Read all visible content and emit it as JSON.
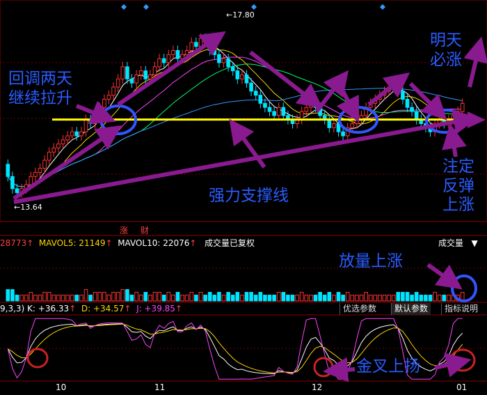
{
  "colors": {
    "up": "#ff3333",
    "down": "#00e5ff",
    "annotation_text": "#2a5cff",
    "arrow": "#8a1a8f",
    "support": "#ffff00",
    "circle_blue": "#3355ff",
    "circle_red": "#cc2222"
  },
  "price_panel": {
    "high_label": "17.80",
    "low_label": "13.64",
    "calendar_marks": [
      "涨",
      "财"
    ]
  },
  "volume_panel": {
    "vol_value": "28773",
    "mavol5_label": "MAVOL5: 21149",
    "mavol10_label": "MAVOL10: 22076",
    "note": "成交量已复权",
    "selector": "成交量",
    "selector_arrow": "▼"
  },
  "kdj_panel": {
    "param_label": "9,3,3)",
    "k_label": "K: +36.33",
    "d_label": "D: +34.57",
    "j_label": "J: +39.85",
    "tabs": [
      "优选参数",
      "默认参数",
      "指标说明"
    ]
  },
  "x_axis": {
    "month_labels": [
      "10",
      "11",
      "12",
      "01"
    ]
  },
  "annotations": {
    "left": "回调两天\n继续拉升",
    "support": "强力支撑线",
    "tomorrow": "明天\n必涨",
    "rebound": "注定\n反弹\n上涨",
    "volume": "放量上涨",
    "golden_cross": "金叉上扬"
  },
  "chart_data": {
    "type": "candlestick",
    "price_range": [
      13.4,
      18.2
    ],
    "x": [
      "1",
      "2",
      "3",
      "4",
      "5",
      "6",
      "7",
      "8",
      "9",
      "10",
      "11",
      "12",
      "13",
      "14",
      "15",
      "16",
      "17",
      "18",
      "19",
      "20",
      "21",
      "22",
      "23",
      "24",
      "25",
      "26",
      "27",
      "28",
      "29",
      "30",
      "31",
      "32",
      "33",
      "34",
      "35",
      "36",
      "37",
      "38",
      "39",
      "40",
      "41",
      "42",
      "43",
      "44",
      "45",
      "46",
      "47",
      "48",
      "49",
      "50",
      "51",
      "52",
      "53",
      "54",
      "55",
      "56",
      "57",
      "58",
      "59",
      "60",
      "61",
      "62",
      "63",
      "64",
      "65",
      "66",
      "67",
      "68",
      "69",
      "70",
      "71",
      "72",
      "73",
      "74",
      "75",
      "76",
      "77",
      "78",
      "79",
      "80",
      "81",
      "82",
      "83",
      "84",
      "85",
      "86",
      "87",
      "88",
      "89",
      "90",
      "91",
      "92",
      "93",
      "94",
      "95",
      "96",
      "97",
      "98",
      "99",
      "100"
    ],
    "open": [
      14.5,
      14.2,
      13.9,
      13.8,
      13.9,
      14.0,
      14.2,
      14.3,
      14.4,
      14.6,
      14.8,
      14.9,
      15.0,
      15.1,
      15.2,
      15.3,
      15.2,
      15.3,
      15.6,
      15.5,
      15.7,
      15.9,
      16.1,
      16.2,
      16.4,
      16.6,
      16.9,
      16.6,
      16.5,
      16.7,
      16.8,
      16.6,
      16.7,
      16.9,
      17.1,
      17.0,
      17.2,
      17.3,
      17.1,
      17.2,
      17.3,
      17.5,
      17.4,
      17.6,
      17.5,
      17.3,
      17.2,
      17.0,
      17.1,
      16.9,
      16.8,
      16.6,
      16.7,
      16.5,
      16.3,
      16.2,
      16.0,
      15.9,
      15.8,
      15.7,
      15.9,
      15.7,
      15.6,
      15.5,
      15.6,
      15.8,
      15.9,
      16.0,
      15.9,
      15.7,
      15.6,
      15.4,
      15.5,
      15.3,
      15.2,
      15.4,
      15.5,
      15.6,
      15.7,
      15.9,
      16.0,
      16.1,
      16.2,
      16.3,
      16.4,
      16.5,
      16.3,
      16.1,
      15.9,
      15.8,
      15.6,
      15.5,
      15.4,
      15.3,
      15.5,
      15.6,
      15.5,
      15.6,
      15.7,
      15.8
    ],
    "close": [
      14.2,
      13.9,
      13.8,
      13.9,
      14.0,
      14.2,
      14.3,
      14.4,
      14.6,
      14.8,
      14.9,
      15.0,
      15.1,
      15.2,
      15.3,
      15.2,
      15.3,
      15.6,
      15.5,
      15.7,
      15.9,
      16.1,
      16.2,
      16.4,
      16.6,
      16.9,
      16.6,
      16.5,
      16.7,
      16.8,
      16.6,
      16.7,
      16.9,
      17.1,
      17.0,
      17.2,
      17.3,
      17.1,
      17.2,
      17.3,
      17.5,
      17.4,
      17.6,
      17.5,
      17.3,
      17.2,
      17.0,
      17.1,
      16.9,
      16.8,
      16.6,
      16.7,
      16.5,
      16.3,
      16.2,
      16.0,
      15.9,
      15.8,
      15.7,
      15.9,
      15.7,
      15.6,
      15.5,
      15.6,
      15.8,
      15.9,
      16.0,
      15.9,
      15.7,
      15.6,
      15.4,
      15.5,
      15.3,
      15.2,
      15.4,
      15.5,
      15.6,
      15.7,
      15.9,
      16.0,
      16.1,
      16.2,
      16.3,
      16.4,
      16.5,
      16.3,
      16.1,
      15.9,
      15.8,
      15.6,
      15.5,
      15.4,
      15.3,
      15.5,
      15.6,
      15.5,
      15.6,
      15.7,
      15.8,
      16.0
    ],
    "support_level": 15.6
  }
}
